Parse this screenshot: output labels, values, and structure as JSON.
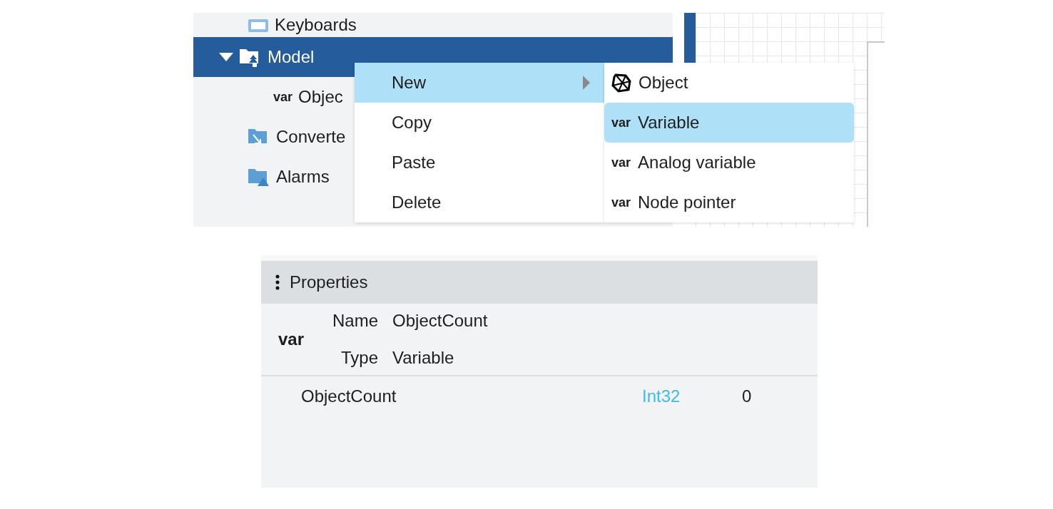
{
  "tree": {
    "items": [
      {
        "kind": "keyboard-folder",
        "label": "Keyboards",
        "selected": false
      },
      {
        "kind": "model-folder",
        "label": "Model",
        "selected": true,
        "expanded": true,
        "children": [
          {
            "kind": "var",
            "badge": "var",
            "label": "Objec",
            "selected": false
          }
        ]
      },
      {
        "kind": "converter-folder",
        "label": "Converte",
        "selected": false
      },
      {
        "kind": "alarm-folder",
        "label": "Alarms",
        "selected": false
      }
    ]
  },
  "context_menu": {
    "items": [
      {
        "label": "New",
        "selected": true,
        "submenu": true
      },
      {
        "label": "Copy",
        "selected": false,
        "submenu": false
      },
      {
        "label": "Paste",
        "selected": false,
        "submenu": false
      },
      {
        "label": "Delete",
        "selected": false,
        "submenu": false
      }
    ]
  },
  "submenu": {
    "items": [
      {
        "kind": "object",
        "label": "Object",
        "selected": false
      },
      {
        "kind": "var",
        "badge": "var",
        "label": "Variable",
        "selected": true
      },
      {
        "kind": "var",
        "badge": "var",
        "label": "Analog variable",
        "selected": false
      },
      {
        "kind": "var",
        "badge": "var",
        "label": "Node pointer",
        "selected": false
      }
    ]
  },
  "properties": {
    "title": "Properties",
    "badge": "var",
    "fields": [
      {
        "label": "Name",
        "value": "ObjectCount"
      },
      {
        "label": "Type",
        "value": "Variable"
      }
    ],
    "rows": [
      {
        "name": "ObjectCount",
        "type": "Int32",
        "value": "0"
      }
    ]
  }
}
